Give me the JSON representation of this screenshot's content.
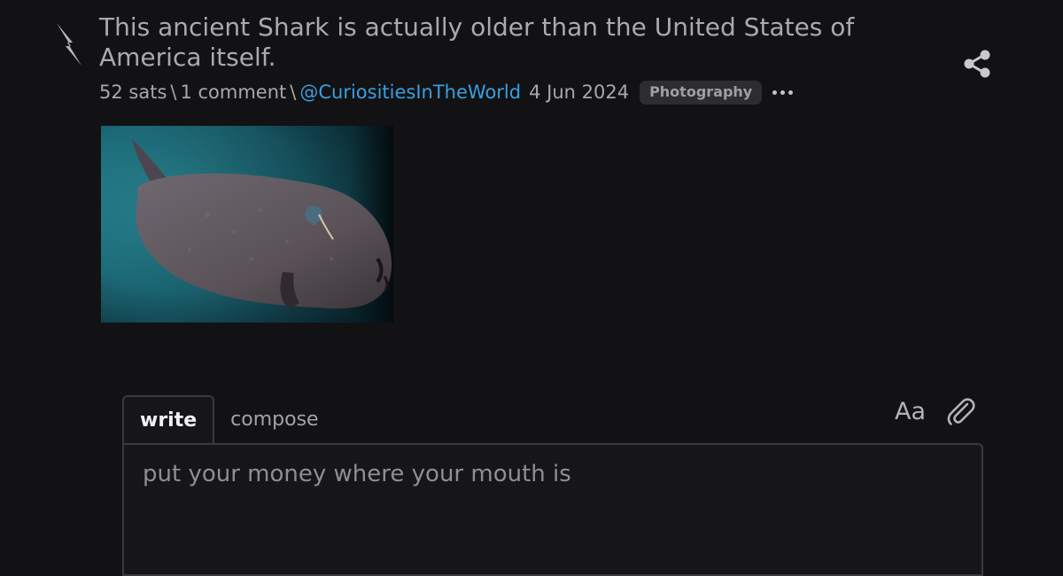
{
  "post": {
    "title": "This ancient Shark is actually older than the United States of America itself.",
    "sats": "52 sats",
    "separator": "\\",
    "comments": "1 comment",
    "author": "@CuriositiesInTheWorld",
    "date": "4 Jun 2024",
    "tag": "Photography",
    "image_subject": "greenland shark underwater photo"
  },
  "comment_box": {
    "tabs": [
      {
        "label": "write",
        "active": true
      },
      {
        "label": "compose",
        "active": false
      }
    ],
    "format_label": "Aa",
    "placeholder": "put your money where your mouth is",
    "value": ""
  },
  "icons": {
    "zap": "lightning-bolt-icon",
    "share": "share-icon",
    "more": "ellipsis-icon",
    "attach": "paperclip-icon"
  },
  "colors": {
    "background": "#121214",
    "link": "#3a9fe0",
    "text": "#a8a8ad"
  }
}
